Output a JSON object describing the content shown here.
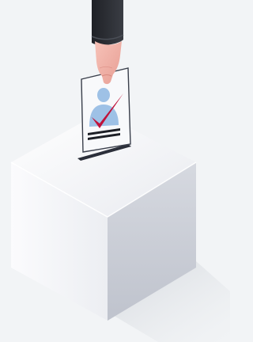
{
  "scene": {
    "subject": "ballot-box-illustration",
    "colors": {
      "background": "#f2f4f6",
      "shadow": "#dfe2e6",
      "box_top": "#f7f8fb",
      "box_front": "#f4f5f8",
      "box_right": "#cfd2da",
      "slot": "#2b2f3a",
      "ballot_paper": "#f8f9fb",
      "ballot_border": "#3a3f4b",
      "candidate_silhouette": "#9ec1e6",
      "checkmark": "#c0123a",
      "ballot_lines": "#1d1f26",
      "sleeve": "#2a2d33",
      "skin": "#f4b2a7",
      "skin_shade": "#e39a90"
    }
  }
}
